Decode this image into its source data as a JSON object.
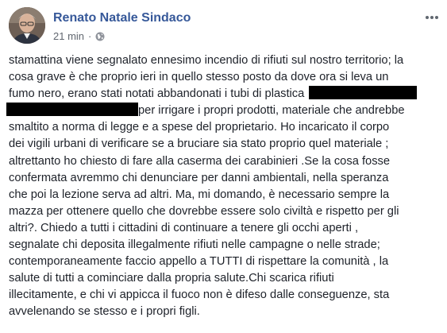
{
  "post": {
    "author": "Renato Natale Sindaco",
    "timestamp": "21 min",
    "separator": "·",
    "privacy_icon": "globe-icon",
    "more_icon": "more-dots-icon",
    "colors": {
      "author_link": "#365899",
      "meta_text": "#616770",
      "body_text": "#1d2129",
      "redaction": "#000000"
    },
    "lines": [
      "stamattina viene segnalato ennesimo incendio di rifiuti sul nostro territorio; la",
      "cosa grave è che proprio ieri in quello stesso posto da dove ora si leva un",
      "fumo nero, erano stati notati abbandonati i tubi di plastica",
      "per irrigare i propri prodotti, materiale che andrebbe",
      "smaltito a norma di legge e a spese del proprietario. Ho incaricato il corpo",
      "dei vigili urbani di verificare se a bruciare sia stato proprio quel materiale ;",
      "altrettanto ho chiesto di fare alla caserma dei carabinieri .Se la cosa fosse",
      "confermata avremmo chi denunciare per danni ambientali, nella speranza",
      "che poi la lezione serva ad altri. Ma, mi domando, è necessario sempre la",
      "mazza per ottenere quello che dovrebbe essere solo civiltà e rispetto per gli",
      "altri?. Chiedo a tutti i cittadini di continuare a tenere gli occhi aperti ,",
      "segnalate chi deposita illegalmente rifiuti nelle campagne o nelle strade;",
      "contemporaneamente faccio appello a TUTTI di rispettare la comunità , la",
      "salute di tutti a cominciare dalla propria salute.Chi scarica rifiuti",
      "illecitamente, e chi vi appicca il fuoco non è difeso dalle conseguenze, sta",
      "avvelenando se stesso e i propri figli."
    ]
  }
}
